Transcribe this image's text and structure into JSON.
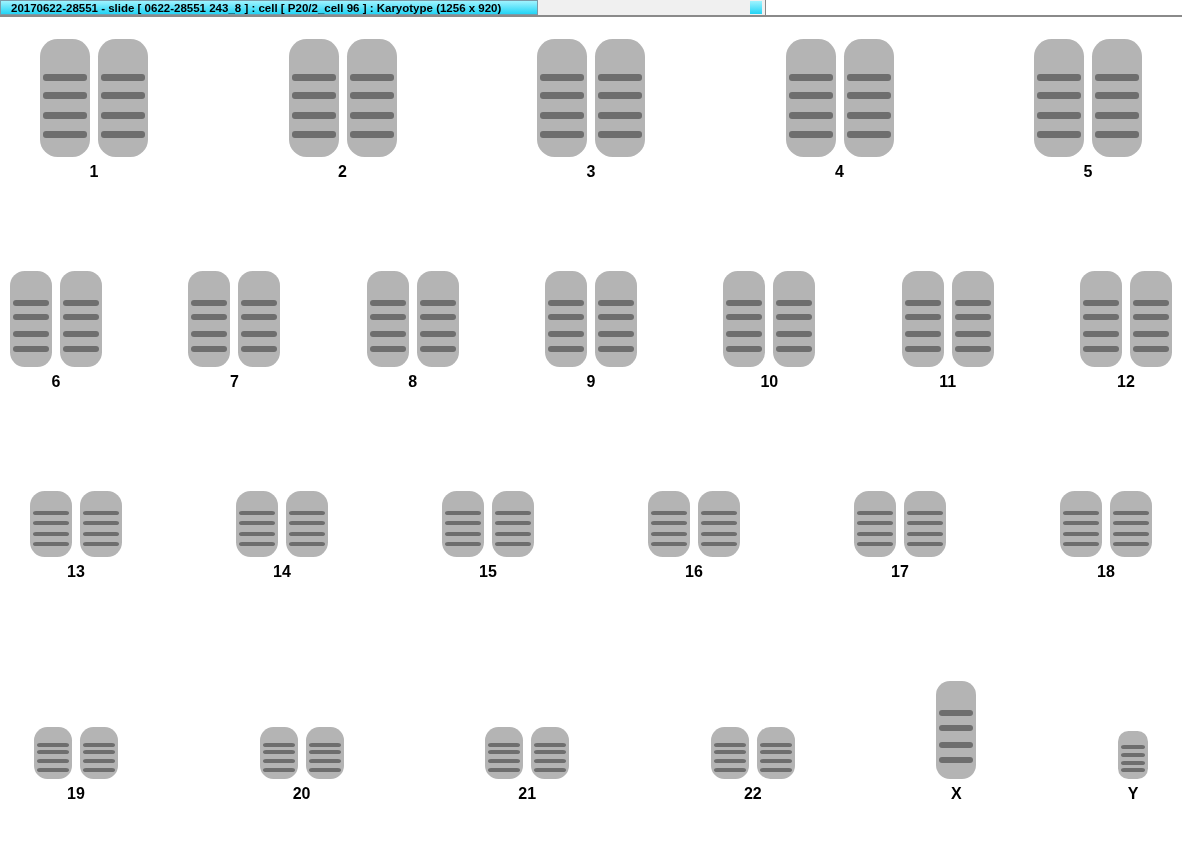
{
  "window": {
    "title": "20170622-28551 - slide [ 0622-28551 243_8 ] : cell [ P20/2_cell 96 ] : Karyotype  (1256 x 920)"
  },
  "karyotype": {
    "rows": [
      {
        "chromosomes": [
          {
            "label": "1"
          },
          {
            "label": "2"
          },
          {
            "label": "3"
          },
          {
            "label": "4"
          },
          {
            "label": "5"
          }
        ]
      },
      {
        "chromosomes": [
          {
            "label": "6"
          },
          {
            "label": "7"
          },
          {
            "label": "8"
          },
          {
            "label": "9"
          },
          {
            "label": "10"
          },
          {
            "label": "11"
          },
          {
            "label": "12"
          }
        ]
      },
      {
        "chromosomes": [
          {
            "label": "13"
          },
          {
            "label": "14"
          },
          {
            "label": "15"
          },
          {
            "label": "16"
          },
          {
            "label": "17"
          },
          {
            "label": "18"
          }
        ]
      },
      {
        "chromosomes": [
          {
            "label": "19"
          },
          {
            "label": "20"
          },
          {
            "label": "21"
          },
          {
            "label": "22"
          },
          {
            "label": "X"
          },
          {
            "label": "Y"
          }
        ]
      }
    ]
  }
}
